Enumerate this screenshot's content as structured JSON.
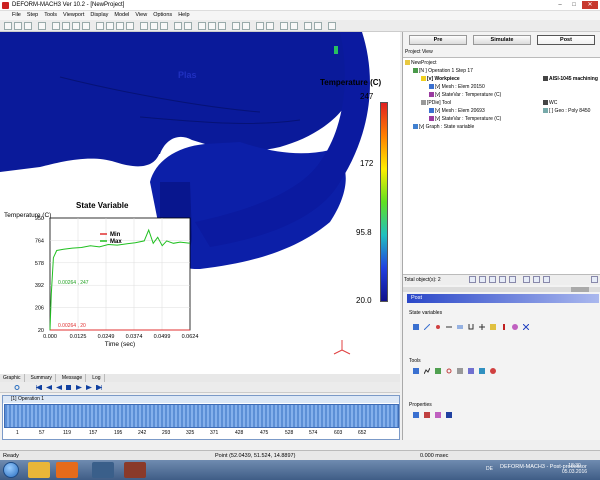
{
  "window": {
    "title": "DEFORM-MACH3  Ver 10.2 - [NewProject]",
    "min": "–",
    "max": "□",
    "close": "✕"
  },
  "menu": [
    "File",
    "Step",
    "Tools",
    "Viewport",
    "Display",
    "Model",
    "View",
    "Options",
    "Help"
  ],
  "viewport": {
    "legend": {
      "title": "Temperature (C)",
      "max": "247",
      "v172": "172",
      "v95": "95.8",
      "min": "20.0"
    },
    "label_fragment": "Plas",
    "chart_title": "State Variable"
  },
  "chart_data": {
    "type": "line",
    "title": "State Variable",
    "xlabel": "Time (sec)",
    "ylabel": "Temperature (C)",
    "xlim": [
      0,
      0.0624
    ],
    "ylim": [
      20,
      950
    ],
    "x_ticks": [
      "0.000",
      "0.0125",
      "0.0249",
      "0.0374",
      "0.0499",
      "0.0624"
    ],
    "y_ticks": [
      "950",
      "764",
      "578",
      "392",
      "206",
      "20"
    ],
    "series": [
      {
        "name": "Min",
        "color": "#e03030",
        "x": [
          0.0,
          0.0624
        ],
        "y": [
          20,
          20
        ]
      },
      {
        "name": "Max",
        "color": "#20c020",
        "x": [
          0.0,
          0.0006,
          0.0015,
          0.003,
          0.006,
          0.01,
          0.014,
          0.018,
          0.022,
          0.026,
          0.03,
          0.034,
          0.038,
          0.042,
          0.044,
          0.046,
          0.048,
          0.05,
          0.052,
          0.055,
          0.058,
          0.0624
        ],
        "y": [
          20,
          320,
          620,
          680,
          690,
          700,
          705,
          720,
          710,
          730,
          725,
          735,
          745,
          760,
          850,
          740,
          790,
          720,
          760,
          740,
          750,
          740
        ]
      }
    ],
    "legend": "top-center",
    "annotations": [
      "0.00264 , 247",
      "0.00264 , 20"
    ]
  },
  "view_tabs": [
    "Graphic",
    "Summary",
    "Message",
    "Log"
  ],
  "timeline": {
    "operation": "[1] Operation 1",
    "ticks": [
      "1",
      "57",
      "119",
      "157",
      "195",
      "242",
      "293",
      "325",
      "371",
      "428",
      "475",
      "528",
      "574",
      "603",
      "652"
    ]
  },
  "side": {
    "modes": [
      "Pre",
      "Simulate",
      "Post"
    ],
    "project_view": "Project View",
    "tree": {
      "root": "NewProject",
      "op": "[N ] Operation 1  Step 17",
      "workpiece": "[v] Workpiece",
      "workpiece_mat": "AISI-1045 machining",
      "mesh1": "[v] Mesh : Elem 20150",
      "statevar1": "[v] StateVar : Temperature (C)",
      "tool": "[PDie] Tool",
      "tool_mat": "WC",
      "mesh2": "[v] Mesh : Elem 20693",
      "geo": "[ ] Geo : Poly 8450",
      "statevar2": "[v] StateVar : Temperature (C)",
      "graph": "[v] Graph : State variable"
    },
    "total_objects": "Total object(s): 2",
    "post_header": "Post",
    "state_variables": "State variables",
    "tools": "Tools",
    "properties": "Properties"
  },
  "status": {
    "ready": "Ready",
    "point": "Point (52.0439, 51.524, 14.8897)",
    "msec": "0.000 msec"
  },
  "taskbar": {
    "task": "DEFORM-MACH3 - Post-processor",
    "lang": "DE",
    "time": "18:30",
    "date": "05.03.2016"
  },
  "colors": {
    "blue_body": "#0a1a9a",
    "panel_header": "#2a47c8",
    "timeline": "#5c8fd6"
  }
}
